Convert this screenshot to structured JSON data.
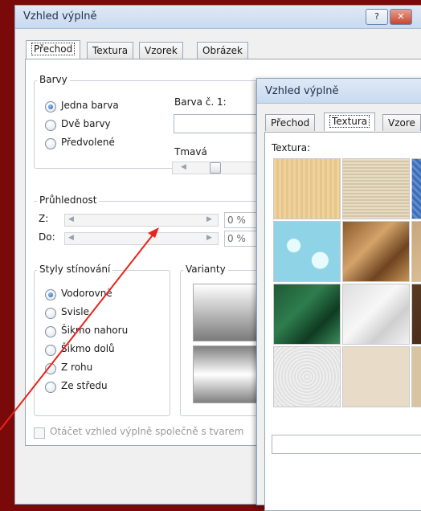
{
  "main_dialog": {
    "title": "Vzhled výplně",
    "help_button": "?",
    "close_button": "✕",
    "tabs": [
      {
        "label": "Přechod",
        "active": true
      },
      {
        "label": "Textura",
        "active": false
      },
      {
        "label": "Vzorek",
        "active": false
      },
      {
        "label": "Obrázek",
        "active": false
      }
    ],
    "colors_group": {
      "label": "Barvy",
      "options": [
        {
          "label": "Jedna barva",
          "selected": true
        },
        {
          "label": "Dvě barvy",
          "selected": false
        },
        {
          "label": "Předvolené",
          "selected": false
        }
      ],
      "color_label": "Barva č. 1:",
      "shade_label": "Tmavá"
    },
    "transparency_group": {
      "label": "Průhlednost",
      "from_label": "Z:",
      "from_value": "0 %",
      "to_label": "Do:",
      "to_value": "0 %"
    },
    "shading_group": {
      "label": "Styly stínování",
      "options": [
        {
          "label": "Vodorovně",
          "selected": true
        },
        {
          "label": "Svisle",
          "selected": false
        },
        {
          "label": "Šikmo nahoru",
          "selected": false
        },
        {
          "label": "Šikmo dolů",
          "selected": false
        },
        {
          "label": "Z rohu",
          "selected": false
        },
        {
          "label": "Ze středu",
          "selected": false
        }
      ]
    },
    "variants_label": "Varianty",
    "rotate_checkbox_label": "Otáčet vzhled výplně společně s tvarem"
  },
  "texture_dialog": {
    "title": "Vzhled výplně",
    "tabs": [
      {
        "label": "Přechod",
        "active": false
      },
      {
        "label": "Textura",
        "active": true
      },
      {
        "label": "Vzore",
        "active": false
      }
    ],
    "texture_label": "Textura:",
    "textures": [
      "papyrus",
      "canvas",
      "denim",
      "water-droplets",
      "paper-bag",
      "fish-fossil",
      "green-marble",
      "white-marble",
      "brown-marble",
      "granite",
      "sand",
      "medium-wood"
    ]
  },
  "colors": {
    "background": "#7a0a0a",
    "annotation_arrow": "#e8241b",
    "selection_accent": "#1d5fb3"
  }
}
